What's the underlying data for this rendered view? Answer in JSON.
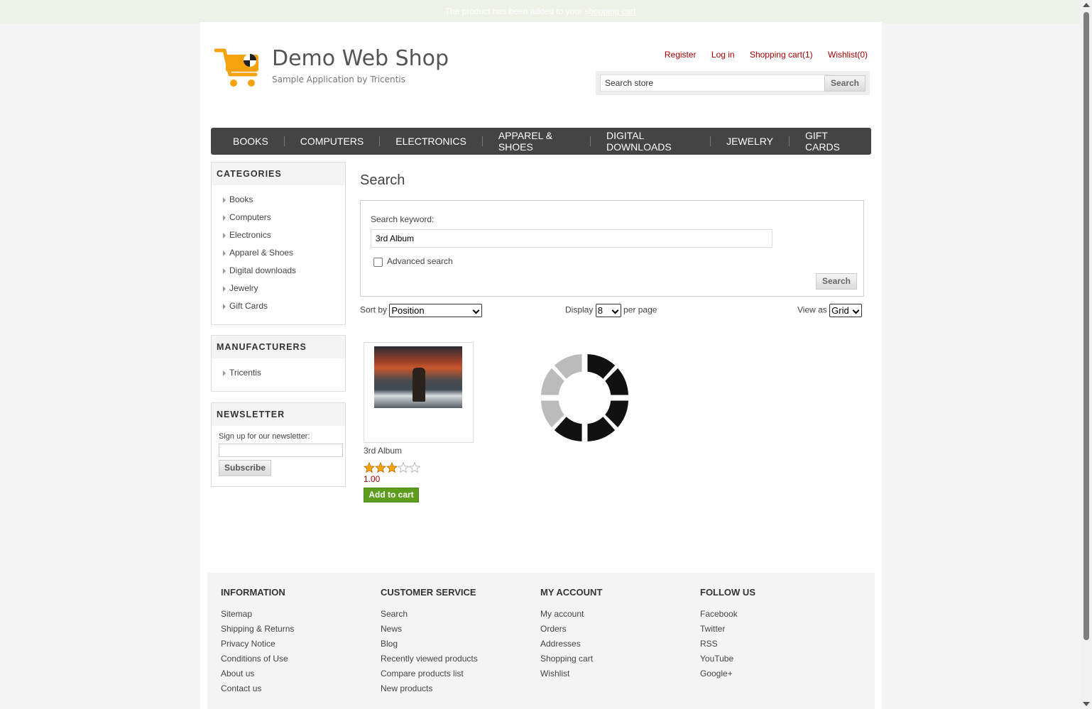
{
  "notification": {
    "text": "The product has been added to your",
    "link": "shopping cart"
  },
  "header": {
    "title": "Demo Web Shop",
    "subtitle": "Sample Application by Tricentis",
    "links": {
      "register": "Register",
      "login": "Log in",
      "cart": "Shopping cart(1)",
      "wishlist": "Wishlist(0)"
    },
    "search": {
      "value": "Search store",
      "button": "Search"
    }
  },
  "topmenu": [
    "BOOKS",
    "COMPUTERS",
    "ELECTRONICS",
    "APPAREL & SHOES",
    "DIGITAL DOWNLOADS",
    "JEWELRY",
    "GIFT CARDS"
  ],
  "sidebar": {
    "categories": {
      "title": "CATEGORIES",
      "items": [
        "Books",
        "Computers",
        "Electronics",
        "Apparel & Shoes",
        "Digital downloads",
        "Jewelry",
        "Gift Cards"
      ]
    },
    "manufacturers": {
      "title": "MANUFACTURERS",
      "items": [
        "Tricentis"
      ]
    },
    "newsletter": {
      "title": "NEWSLETTER",
      "label": "Sign up for our newsletter:",
      "button": "Subscribe"
    }
  },
  "main": {
    "title": "Search",
    "keyword_label": "Search keyword:",
    "keyword_value": "3rd Album",
    "advanced_label": "Advanced search",
    "advanced_checked": false,
    "search_button": "Search",
    "sort_label": "Sort by",
    "sort_value": "Position",
    "display_label": "Display",
    "display_value": "8",
    "per_page_label": "per page",
    "view_label": "View as",
    "view_value": "Grid"
  },
  "product": {
    "title": "3rd Album",
    "rating": 3,
    "rating_max": 5,
    "price": "1.00",
    "add_to_cart": "Add to cart"
  },
  "colors": {
    "link_red": "#aa0000",
    "menu_bg": "#444444",
    "add_to_cart_green": "#5e9c1e",
    "star": "#f5a20c"
  },
  "footer": {
    "information": {
      "title": "INFORMATION",
      "items": [
        "Sitemap",
        "Shipping & Returns",
        "Privacy Notice",
        "Conditions of Use",
        "About us",
        "Contact us"
      ]
    },
    "customer_service": {
      "title": "CUSTOMER SERVICE",
      "items": [
        "Search",
        "News",
        "Blog",
        "Recently viewed products",
        "Compare products list",
        "New products"
      ]
    },
    "my_account": {
      "title": "MY ACCOUNT",
      "items": [
        "My account",
        "Orders",
        "Addresses",
        "Shopping cart",
        "Wishlist"
      ]
    },
    "follow_us": {
      "title": "FOLLOW US",
      "items": [
        "Facebook",
        "Twitter",
        "RSS",
        "YouTube",
        "Google+"
      ]
    }
  }
}
